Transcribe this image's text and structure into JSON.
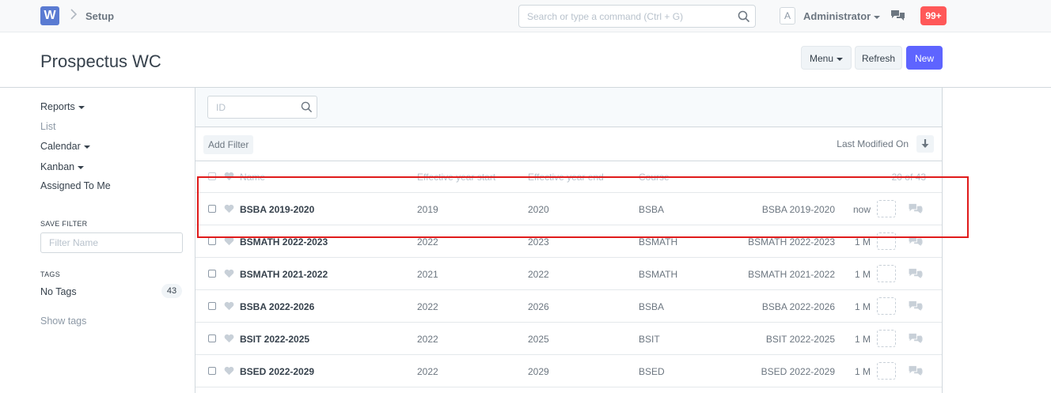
{
  "navbar": {
    "logo_letter": "W",
    "breadcrumb": "Setup",
    "search_placeholder": "Search or type a command (Ctrl + G)",
    "avatar_letter": "A",
    "user_name": "Administrator",
    "notification_count": "99+"
  },
  "page": {
    "title": "Prospectus WC",
    "menu_label": "Menu",
    "refresh_label": "Refresh",
    "new_label": "New"
  },
  "sidebar": {
    "items": [
      {
        "label": "Reports",
        "has_caret": true
      },
      {
        "label": "List",
        "has_caret": false
      },
      {
        "label": "Calendar",
        "has_caret": true
      },
      {
        "label": "Kanban",
        "has_caret": true
      },
      {
        "label": "Assigned To Me",
        "has_caret": false
      }
    ],
    "save_filter_label": "SAVE FILTER",
    "filter_name_placeholder": "Filter Name",
    "tags_label": "TAGS",
    "no_tags_label": "No Tags",
    "no_tags_count": "43",
    "show_tags_label": "Show tags"
  },
  "list": {
    "id_placeholder": "ID",
    "add_filter_label": "Add Filter",
    "sort_label": "Last Modified On",
    "columns": {
      "name": "Name",
      "start": "Effective year start",
      "end": "Effective year end",
      "course": "Course",
      "count": "20 of 43"
    },
    "rows": [
      {
        "name": "BSBA 2019-2020",
        "start": "2019",
        "end": "2020",
        "course": "BSBA",
        "title": "BSBA 2019-2020",
        "modified": "now",
        "comments": "0"
      },
      {
        "name": "BSMATH 2022-2023",
        "start": "2022",
        "end": "2023",
        "course": "BSMATH",
        "title": "BSMATH 2022-2023",
        "modified": "1 M",
        "comments": "0"
      },
      {
        "name": "BSMATH 2021-2022",
        "start": "2021",
        "end": "2022",
        "course": "BSMATH",
        "title": "BSMATH 2021-2022",
        "modified": "1 M",
        "comments": "0"
      },
      {
        "name": "BSBA 2022-2026",
        "start": "2022",
        "end": "2026",
        "course": "BSBA",
        "title": "BSBA 2022-2026",
        "modified": "1 M",
        "comments": "0"
      },
      {
        "name": "BSIT 2022-2025",
        "start": "2022",
        "end": "2025",
        "course": "BSIT",
        "title": "BSIT 2022-2025",
        "modified": "1 M",
        "comments": "0"
      },
      {
        "name": "BSED 2022-2029",
        "start": "2022",
        "end": "2029",
        "course": "BSED",
        "title": "BSED 2022-2029",
        "modified": "1 M",
        "comments": "0"
      }
    ]
  },
  "colors": {
    "primary": "#5e64ff",
    "notification": "#ff5858",
    "highlight": "#e01b1b"
  }
}
